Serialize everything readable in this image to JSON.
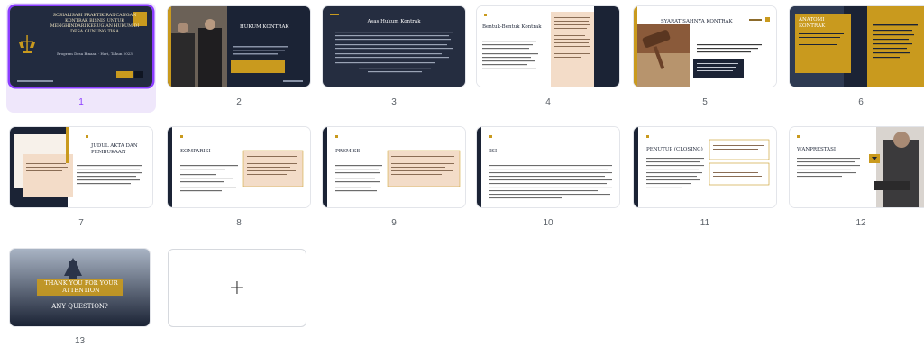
{
  "colors": {
    "accent": "#8b3dff",
    "navy": "#1b2335",
    "gold": "#c99a1e",
    "peach": "#f3dcc8"
  },
  "slides": [
    {
      "number": "1",
      "selected": true,
      "title": "SOSIALISASI PRAKTIK RANCANGAN KONTRAK BISNIS UNTUK MENGHINDARI KERUGIAN HUKUM DI DESA GUNUNG TIGA",
      "subtitle": "Program Desa Binaan · Hari, Tahun 2023"
    },
    {
      "number": "2",
      "title": "HUKUM KONTRAK"
    },
    {
      "number": "3",
      "title": "Asas Hukum Kontrak"
    },
    {
      "number": "4",
      "title": "Bentuk-Bentuk Kontrak"
    },
    {
      "number": "5",
      "title": "SYARAT SAHNYA KONTRAK"
    },
    {
      "number": "6",
      "title": "ANATOMI KONTRAK"
    },
    {
      "number": "7",
      "title": "JUDUL AKTA DAN PEMBUKAAN"
    },
    {
      "number": "8",
      "title": "KOMPARISI"
    },
    {
      "number": "9",
      "title": "PREMISE"
    },
    {
      "number": "10",
      "title": "ISI"
    },
    {
      "number": "11",
      "title": "PENUTUP (CLOSING)"
    },
    {
      "number": "12",
      "title": "WANPRESTASI"
    },
    {
      "number": "13",
      "title": "THANK YOU FOR YOUR ATTENTION",
      "subtitle": "ANY QUESTION?"
    }
  ],
  "add_page": {
    "label": "+"
  }
}
